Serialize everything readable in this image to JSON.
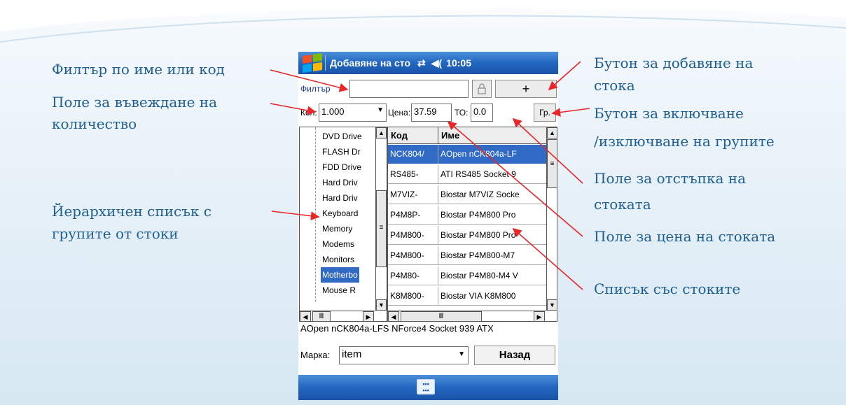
{
  "annotations": {
    "filter": "Филтър по име или код",
    "qty_1": "Поле за въвеждане на",
    "qty_2": "количество",
    "hierarchy_1": "Йерархичен списък с",
    "hierarchy_2": "групите от стоки",
    "add_1": "Бутон за добавяне на",
    "add_2": "стока",
    "groups_1": "Бутон за включване",
    "groups_2": "/изключване на групите",
    "discount_1": "Поле за отстъпка на",
    "discount_2": "стоката",
    "price": "Поле за цена на стоката",
    "list": "Списък със стоките"
  },
  "device": {
    "title": "Добавяне на сто",
    "connectivity_icon": "sync-arrows-icon",
    "volume_icon": "speaker-icon",
    "time": "10:05",
    "filter_label": "Филтър",
    "filter_value": "",
    "lock_icon": "lock-icon",
    "add_label": "+",
    "qty_label": "Кол:",
    "qty_value": "1.000",
    "price_label": "Цена:",
    "price_value": "37.59",
    "discount_label": "ТО:",
    "discount_value": "0.0",
    "groups_label": "Гр.",
    "tree_items": [
      {
        "label": "DVD Drive",
        "selected": false
      },
      {
        "label": "FLASH Dr",
        "selected": false
      },
      {
        "label": "FDD Drive",
        "selected": false
      },
      {
        "label": "Hard Driv",
        "selected": false
      },
      {
        "label": "Hard Driv",
        "selected": false
      },
      {
        "label": "Keyboard",
        "selected": false
      },
      {
        "label": "Memory",
        "selected": false
      },
      {
        "label": "Modems",
        "selected": false
      },
      {
        "label": "Monitors",
        "selected": false
      },
      {
        "label": "Motherbo",
        "selected": true
      },
      {
        "label": "Mouse  R",
        "selected": false
      }
    ],
    "grid_columns": [
      "Код",
      "Име"
    ],
    "grid_rows": [
      {
        "code": "NCK804/",
        "name": "AOpen nCK804a-LF",
        "selected": true
      },
      {
        "code": "RS485-",
        "name": "ATI RS485 Socket 9",
        "selected": false
      },
      {
        "code": "M7VIZ-",
        "name": "Biostar M7VIZ Socke",
        "selected": false
      },
      {
        "code": "P4M8P-",
        "name": "Biostar P4M800 Pro",
        "selected": false
      },
      {
        "code": "P4M800-",
        "name": "Biostar P4M800 Pro",
        "selected": false
      },
      {
        "code": "P4M800-",
        "name": "Biostar P4M800-M7",
        "selected": false
      },
      {
        "code": "P4M80-",
        "name": "Biostar P4M80-M4 V",
        "selected": false
      },
      {
        "code": "K8M800-",
        "name": "Biostar VIA K8M800",
        "selected": false
      }
    ],
    "description": "AOpen nCK804a-LFS NForce4 Socket 939 ATX",
    "brand_label": "Марка:",
    "brand_value": "item",
    "back_label": "Назад",
    "keyboard_icon": "keyboard-icon"
  },
  "colors": {
    "titlebar": "#2166c0",
    "selection": "#316ac5",
    "annotation_text": "#1f5f92",
    "arrow": "#e8262a"
  }
}
